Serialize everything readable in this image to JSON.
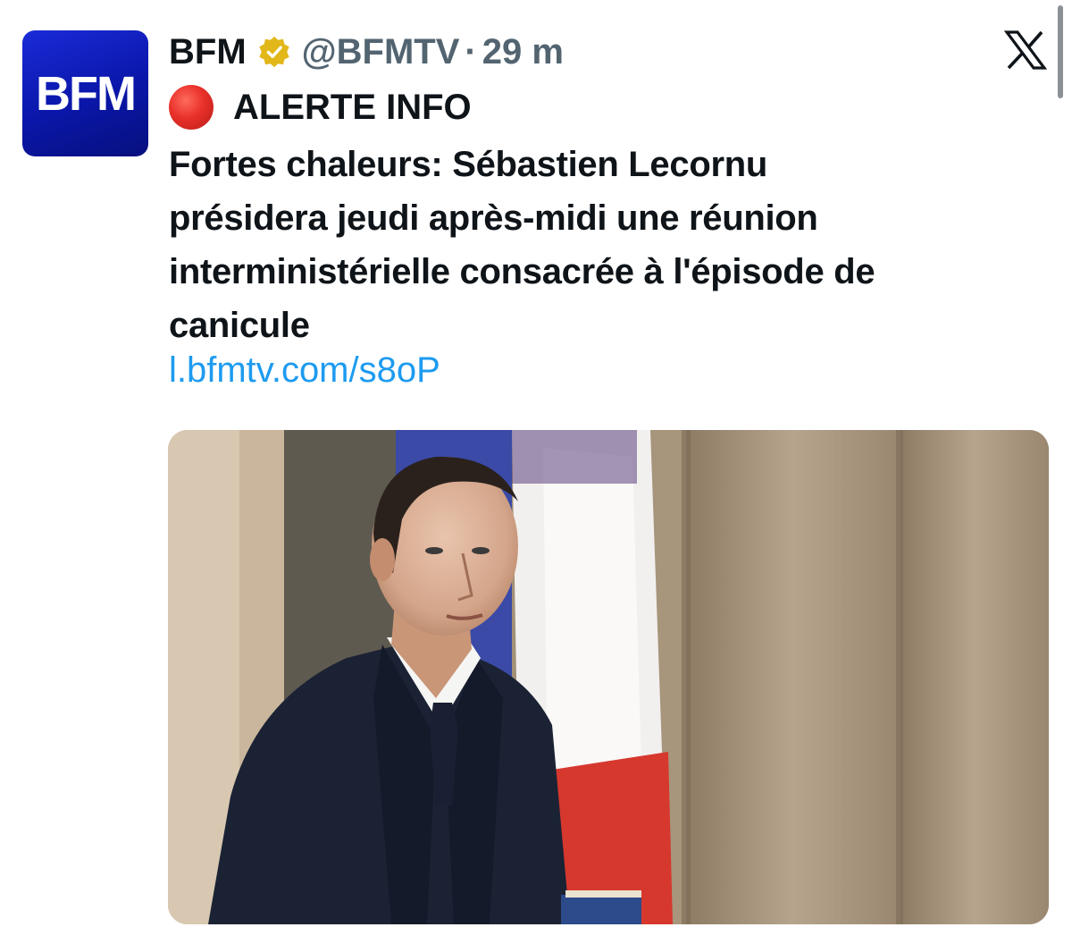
{
  "tweet": {
    "avatar_text": "BFM",
    "author_name": "BFM",
    "handle": "@BFMTV",
    "separator": "·",
    "time": "29 m",
    "alert_label": "ALERTE INFO",
    "text_lines": [
      "Fortes chaleurs: Sébastien Lecornu",
      "présidera jeudi après-midi une réunion",
      "interministérielle consacrée à l'épisode de",
      "canicule"
    ],
    "link": "l.bfmtv.com/s8oP"
  },
  "icons": {
    "verified": "verified-badge-icon",
    "alert": "red-circle-icon",
    "platform": "x-logo-icon"
  },
  "colors": {
    "avatar_blue": "#0a16a8",
    "link_blue": "#1d9bf0",
    "muted_gray": "#536471",
    "verified_gold": "#e2b719",
    "alert_red": "#e8302a"
  }
}
